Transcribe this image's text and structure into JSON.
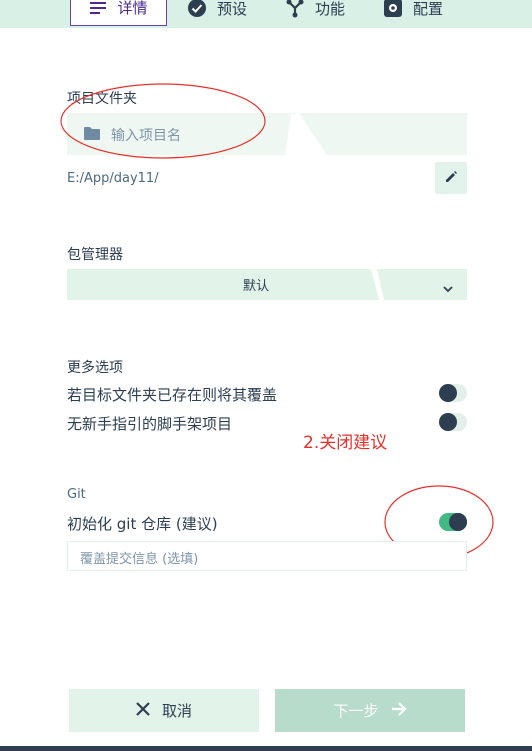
{
  "tabs": [
    {
      "label": "详情",
      "icon": "list-icon",
      "active": true
    },
    {
      "label": "预设",
      "icon": "check-circle-icon",
      "active": false
    },
    {
      "label": "功能",
      "icon": "fork-icon",
      "active": false
    },
    {
      "label": "配置",
      "icon": "gear-icon",
      "active": false
    }
  ],
  "project_folder": {
    "label": "项目文件夹",
    "placeholder": "输入项目名",
    "path": "E:/App/day11/",
    "edit_icon": "pencil-icon"
  },
  "package_manager": {
    "label": "包管理器",
    "selected": "默认"
  },
  "more_options": {
    "label": "更多选项",
    "overwrite_label": "若目标文件夹已存在则将其覆盖",
    "overwrite_on": false,
    "no_guide_label": "无新手指引的脚手架项目",
    "no_guide_on": false
  },
  "annotation": "2.关闭建议",
  "git": {
    "label": "Git",
    "init_label": "初始化 git 仓库 (建议)",
    "init_on": true,
    "commit_placeholder": "覆盖提交信息 (选填)"
  },
  "footer": {
    "cancel_label": "取消",
    "next_label": "下一步"
  },
  "colors": {
    "accent": "#42b983",
    "annotation": "#e8302b",
    "active_tab_border": "#6a3fb5"
  }
}
